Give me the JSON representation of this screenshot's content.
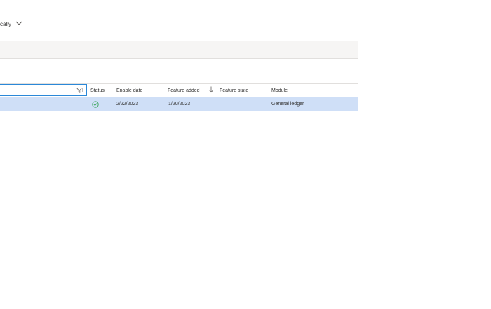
{
  "toolbar": {
    "dropdown_label": "tically"
  },
  "grid": {
    "columns": {
      "status": "Status",
      "enable_date": "Enable date",
      "feature_added": "Feature added",
      "feature_state": "Feature state",
      "module": "Module"
    },
    "sort": {
      "column": "feature_added",
      "direction": "descending"
    },
    "rows": [
      {
        "status_icon": "check-circle-icon",
        "enable_date": "2/22/2023",
        "feature_added": "1/20/2023",
        "feature_state": "",
        "module": "General ledger",
        "selected": true
      }
    ]
  },
  "colors": {
    "selected_row": "#cfdff7",
    "focus_border": "#2b88d8",
    "status_ok": "#3aa65a"
  }
}
